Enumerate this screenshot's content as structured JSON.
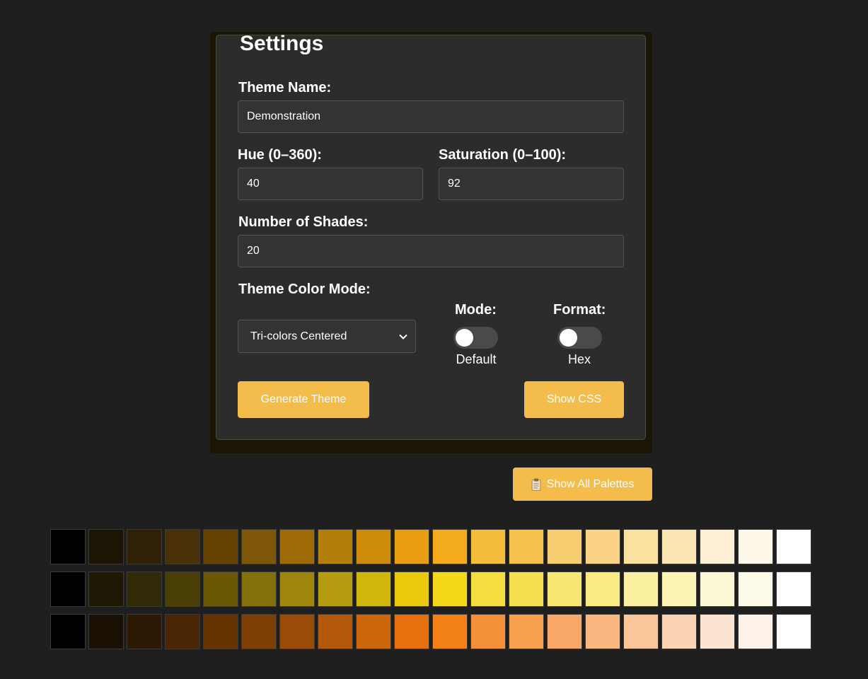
{
  "settings": {
    "title": "Settings",
    "theme_name_label": "Theme Name:",
    "theme_name_value": "Demonstration",
    "hue_label": "Hue (0–360):",
    "hue_value": "40",
    "saturation_label": "Saturation (0–100):",
    "saturation_value": "92",
    "shades_label": "Number of Shades:",
    "shades_value": "20",
    "color_mode_label": "Theme Color Mode:",
    "color_mode_selected": "Tri-colors Centered",
    "mode_label": "Mode:",
    "mode_toggle_state": "Default",
    "format_label": "Format:",
    "format_toggle_state": "Hex",
    "generate_button": "Generate Theme",
    "show_css_button": "Show CSS"
  },
  "show_all_palettes_button": "Show All Palettes",
  "colors": {
    "accent": "#f4bc4a",
    "panel": "#2c2c2c",
    "background": "#1f1f1f"
  },
  "palettes": [
    [
      "#000000",
      "#1c1404",
      "#302006",
      "#493006",
      "#664202",
      "#7e5608",
      "#9e6a06",
      "#b47e0a",
      "#cc8c0a",
      "#e89e10",
      "#f4ac1c",
      "#f4bc3a",
      "#f6c24e",
      "#f8cc70",
      "#fad484",
      "#fbe09e",
      "#fce6b4",
      "#fdf0d6",
      "#fef8ea",
      "#ffffff"
    ],
    [
      "#000000",
      "#1c1804",
      "#302a06",
      "#4a4006",
      "#6a5806",
      "#84700a",
      "#9e860c",
      "#b49c0e",
      "#ceb60a",
      "#eac80c",
      "#f4d81a",
      "#f4de3e",
      "#f6e050",
      "#f8e672",
      "#faea84",
      "#fbf0a0",
      "#fcf4b4",
      "#fdf8d4",
      "#fefce8",
      "#ffffff"
    ],
    [
      "#000000",
      "#1a1004",
      "#2c1a04",
      "#4a2604",
      "#663402",
      "#7e3e04",
      "#9a4c06",
      "#b4580a",
      "#cc660a",
      "#e6700c",
      "#f48018",
      "#f4903a",
      "#f6a04e",
      "#f8a868",
      "#fab880",
      "#fbc69a",
      "#fcd4b4",
      "#fde4d0",
      "#fef2e8",
      "#ffffff"
    ]
  ]
}
